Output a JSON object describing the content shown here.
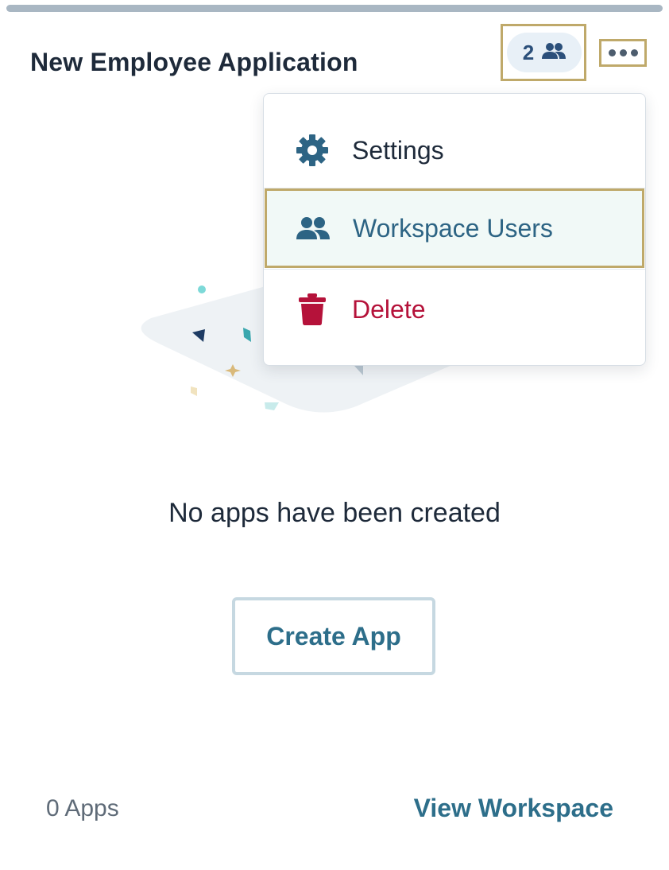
{
  "card": {
    "title": "New Employee Application",
    "user_count": "2",
    "empty_message": "No apps have been created",
    "create_label": "Create App",
    "apps_count": "0 Apps",
    "view_label": "View Workspace"
  },
  "menu": {
    "items": [
      {
        "label": "Settings",
        "icon": "gear-icon"
      },
      {
        "label": "Workspace Users",
        "icon": "users-icon"
      },
      {
        "label": "Delete",
        "icon": "trash-icon"
      }
    ]
  },
  "colors": {
    "accent": "#2d6e8a",
    "danger": "#b5123a",
    "highlight_border": "#bfa96a",
    "title": "#1e2a3a"
  }
}
